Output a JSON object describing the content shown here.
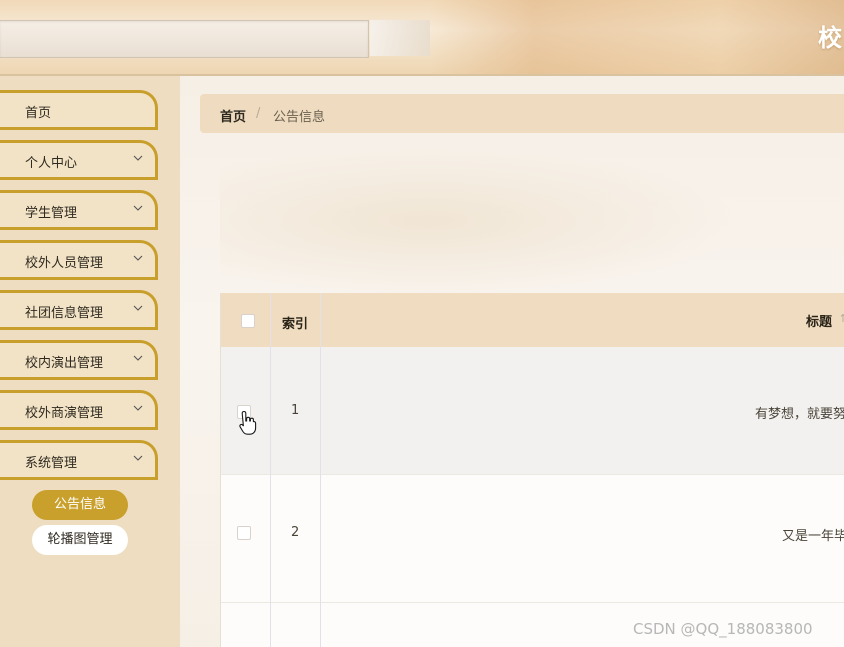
{
  "header": {
    "app_title": "校"
  },
  "sidebar": {
    "items": [
      {
        "label": "首页",
        "has_chevron": false
      },
      {
        "label": "个人中心",
        "has_chevron": true
      },
      {
        "label": "学生管理",
        "has_chevron": true
      },
      {
        "label": "校外人员管理",
        "has_chevron": true
      },
      {
        "label": "社团信息管理",
        "has_chevron": true
      },
      {
        "label": "校内演出管理",
        "has_chevron": true
      },
      {
        "label": "校外商演管理",
        "has_chevron": true
      },
      {
        "label": "系统管理",
        "has_chevron": true
      }
    ],
    "sub_items": [
      {
        "label": "公告信息",
        "active": true
      },
      {
        "label": "轮播图管理",
        "active": false
      }
    ]
  },
  "breadcrumb": {
    "home": "首页",
    "separator": "/",
    "current": "公告信息"
  },
  "table": {
    "columns": {
      "index": "索引",
      "title": "标题"
    },
    "rows": [
      {
        "index": "1",
        "title": "有梦想，就要努"
      },
      {
        "index": "2",
        "title": "又是一年毕"
      }
    ]
  },
  "watermark": "CSDN @QQ_188083800",
  "colors": {
    "accent": "#c9a02b",
    "sidebar_bg": "#eeddc0",
    "header_bg": "#f0dcc0"
  },
  "icons": {
    "chevron": "chevron-down-icon",
    "cursor": "hand-pointer-icon"
  }
}
